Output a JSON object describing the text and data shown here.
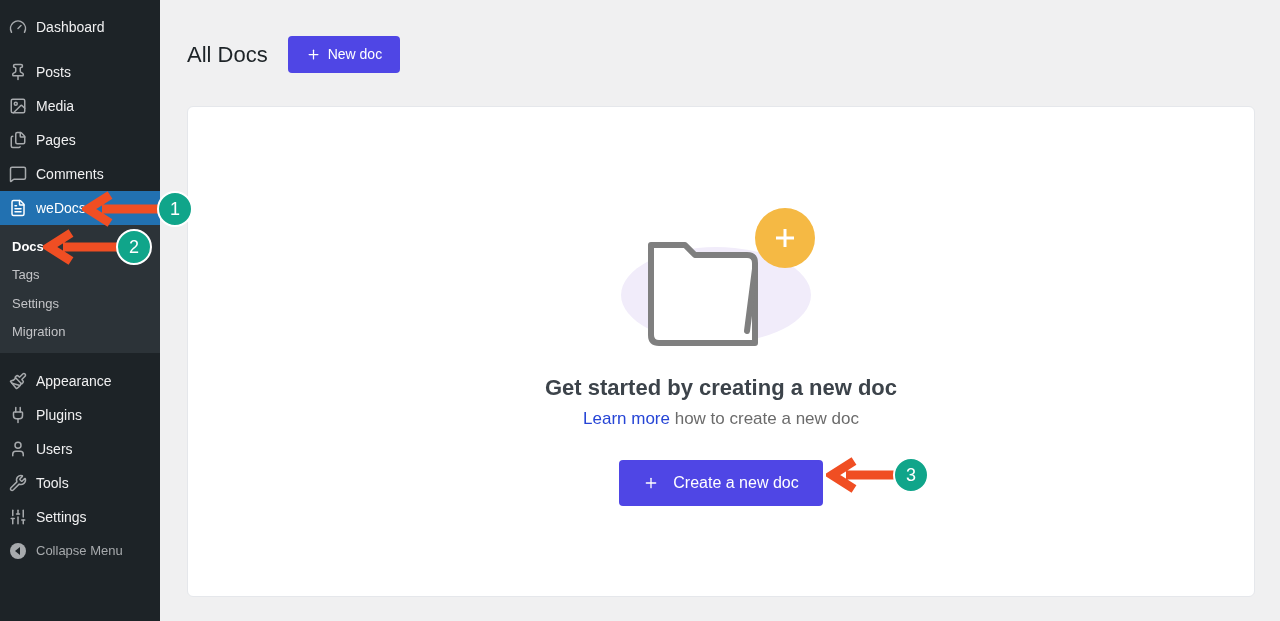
{
  "sidebar": {
    "items": [
      {
        "label": "Dashboard",
        "selected": false
      },
      {
        "label": "Posts",
        "selected": false
      },
      {
        "label": "Media",
        "selected": false
      },
      {
        "label": "Pages",
        "selected": false
      },
      {
        "label": "Comments",
        "selected": false
      },
      {
        "label": "weDocs",
        "selected": true,
        "children": [
          {
            "label": "Docs",
            "selected": true
          },
          {
            "label": "Tags",
            "selected": false
          },
          {
            "label": "Settings",
            "selected": false
          },
          {
            "label": "Migration",
            "selected": false
          }
        ]
      },
      {
        "label": "Appearance",
        "selected": false
      },
      {
        "label": "Plugins",
        "selected": false
      },
      {
        "label": "Users",
        "selected": false
      },
      {
        "label": "Tools",
        "selected": false
      },
      {
        "label": "Settings",
        "selected": false
      }
    ],
    "collapse": "Collapse Menu"
  },
  "header": {
    "title": "All Docs",
    "button": "New doc"
  },
  "empty_state": {
    "heading": "Get started by creating a new doc",
    "link": "Learn more",
    "text": " how to create a new doc",
    "button": "Create a new doc"
  },
  "annotations": [
    "1",
    "2",
    "3"
  ]
}
